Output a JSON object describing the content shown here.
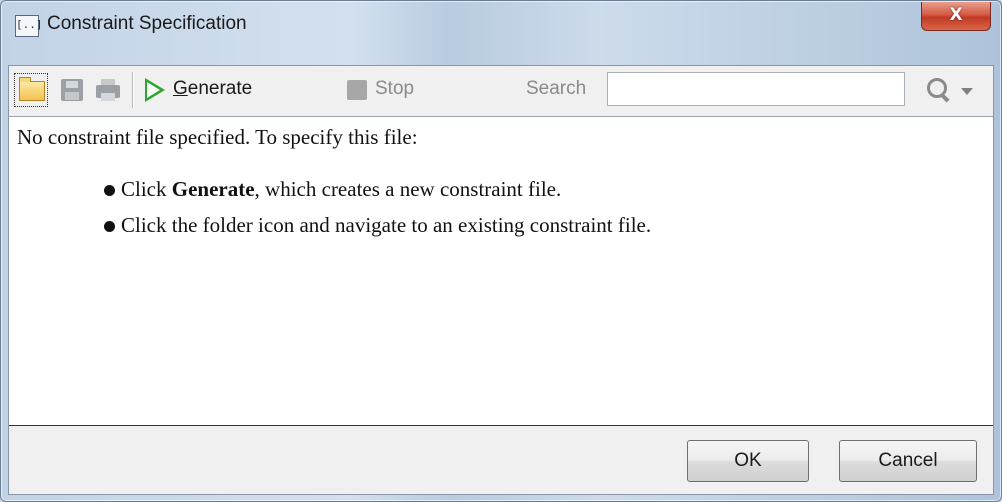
{
  "window": {
    "title": "Constraint Specification",
    "app_icon_text": "[..]",
    "close_label": "X"
  },
  "toolbar": {
    "open_icon": "folder-icon",
    "save_icon": "save-icon",
    "print_icon": "print-icon",
    "generate_mnemonic": "G",
    "generate_rest": "enerate",
    "stop_label": "Stop",
    "search_label": "Search",
    "search_value": "",
    "search_icon": "magnifier-icon",
    "dropdown_icon": "chevron-down-icon"
  },
  "content": {
    "intro": "No constraint file specified. To specify this file:",
    "bullets": [
      {
        "prefix": "Click ",
        "bold": "Generate",
        "suffix": ", which creates a new constraint file."
      },
      {
        "prefix": "Click the folder icon and navigate to an existing constraint file.",
        "bold": "",
        "suffix": ""
      }
    ]
  },
  "footer": {
    "ok_label": "OK",
    "cancel_label": "Cancel"
  },
  "colors": {
    "play_green": "#2fa52f",
    "close_red": "#c13a23",
    "disabled_gray": "#8a8a8a"
  }
}
